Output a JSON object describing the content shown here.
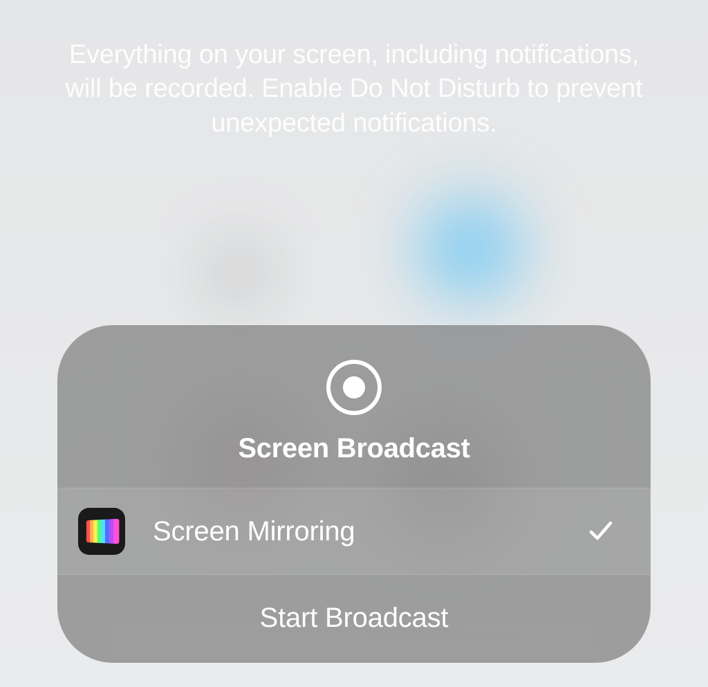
{
  "info_text": "Everything on your screen, including notifications, will be recorded. Enable Do Not Disturb to prevent unexpected notifications.",
  "panel": {
    "title": "Screen Broadcast",
    "destination": {
      "app_name": "Screen Mirroring",
      "selected": true
    },
    "action_label": "Start Broadcast"
  }
}
